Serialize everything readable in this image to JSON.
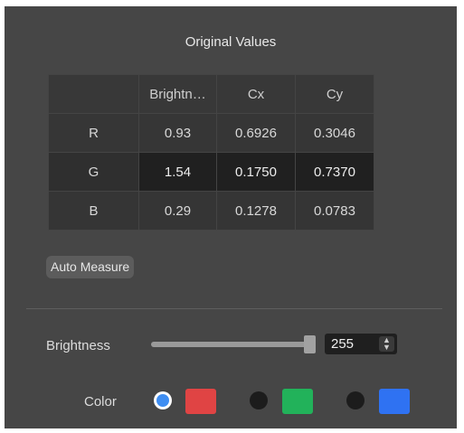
{
  "section_title": "Original Values",
  "table": {
    "headers": [
      "",
      "Brightn…",
      "Cx",
      "Cy"
    ],
    "rows": [
      {
        "label": "R",
        "brightness": "0.93",
        "cx": "0.6926",
        "cy": "0.3046"
      },
      {
        "label": "G",
        "brightness": "1.54",
        "cx": "0.1750",
        "cy": "0.7370"
      },
      {
        "label": "B",
        "brightness": "0.29",
        "cx": "0.1278",
        "cy": "0.0783"
      }
    ]
  },
  "auto_measure_label": "Auto Measure",
  "brightness": {
    "label": "Brightness",
    "value": "255",
    "slider_fraction": 1.0
  },
  "color": {
    "label": "Color",
    "selected": "red",
    "swatches": [
      {
        "name": "red",
        "hex": "#e04444"
      },
      {
        "name": "green",
        "hex": "#22b25a"
      },
      {
        "name": "blue",
        "hex": "#2f72f2"
      }
    ]
  }
}
